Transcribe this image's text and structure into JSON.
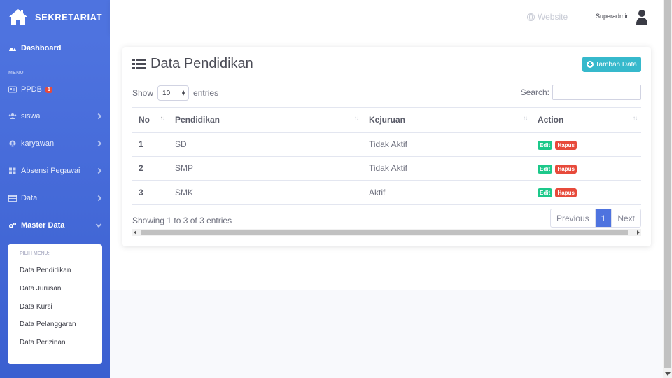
{
  "brand": {
    "name": "SEKRETARIAT",
    "icon": "house-icon"
  },
  "sidebar": {
    "dashboard": {
      "label": "Dashboard",
      "icon": "tachometer-icon"
    },
    "menu_heading": "MENU",
    "items": [
      {
        "label": "PPDB",
        "icon": "id-card-icon",
        "badge": "1"
      },
      {
        "label": "siswa",
        "icon": "users-icon"
      },
      {
        "label": "karyawan",
        "icon": "user-circle-icon"
      },
      {
        "label": "Absensi Pegawai",
        "icon": "grid-icon"
      },
      {
        "label": "Data",
        "icon": "table-icon"
      },
      {
        "label": "Master Data",
        "icon": "cogs-icon"
      }
    ],
    "submenu": {
      "heading": "PILIH MENU:",
      "items": [
        "Data Pendidikan",
        "Data Jurusan",
        "Data Kursi",
        "Data Pelanggaran",
        "Data Perizinan"
      ]
    }
  },
  "topbar": {
    "website": "Website",
    "user": "Superadmin"
  },
  "card": {
    "title": "Data Pendidikan",
    "add_button": "Tambah Data",
    "show_label": "Show",
    "entries_value": "10",
    "entries_label": "entries",
    "search_label": "Search:",
    "search_value": ""
  },
  "table": {
    "columns": [
      "No",
      "Pendidikan",
      "Kejuruan",
      "Action"
    ],
    "rows": [
      {
        "no": "1",
        "pendidikan": "SD",
        "kejuruan": "Tidak Aktif"
      },
      {
        "no": "2",
        "pendidikan": "SMP",
        "kejuruan": "Tidak Aktif"
      },
      {
        "no": "3",
        "pendidikan": "SMK",
        "kejuruan": "Aktif"
      }
    ],
    "edit_label": "Edit",
    "delete_label": "Hapus"
  },
  "footer": {
    "info": "Showing 1 to 3 of 3 entries",
    "previous": "Previous",
    "current_page": "1",
    "next": "Next"
  },
  "colors": {
    "primary": "#4e73df",
    "info": "#36b9cc",
    "success": "#1cc88a",
    "danger": "#e74a3b"
  }
}
